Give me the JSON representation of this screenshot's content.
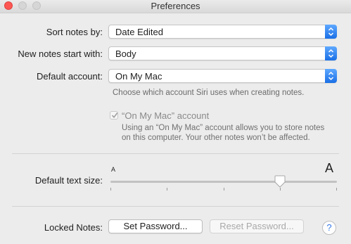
{
  "window": {
    "title": "Preferences"
  },
  "sort_notes": {
    "label": "Sort notes by:",
    "value": "Date Edited"
  },
  "new_notes": {
    "label": "New notes start with:",
    "value": "Body"
  },
  "default_account": {
    "label": "Default account:",
    "value": "On My Mac",
    "hint": "Choose which account Siri uses when creating notes."
  },
  "on_my_mac": {
    "checked": true,
    "label": "“On My Mac” account",
    "description_line1": "Using an “On My Mac” account allows you to store notes",
    "description_line2": "on this computer. Your other notes won’t be affected."
  },
  "text_size": {
    "label": "Default text size:",
    "small_glyph": "A",
    "large_glyph": "A",
    "tick_count": 5,
    "level_fraction": 0.75
  },
  "locked_notes": {
    "label": "Locked Notes:",
    "set_password": "Set Password...",
    "reset_password": "Reset Password..."
  },
  "help": {
    "glyph": "?"
  },
  "colors": {
    "accent": "#3579e6",
    "close": "#fc5753"
  }
}
